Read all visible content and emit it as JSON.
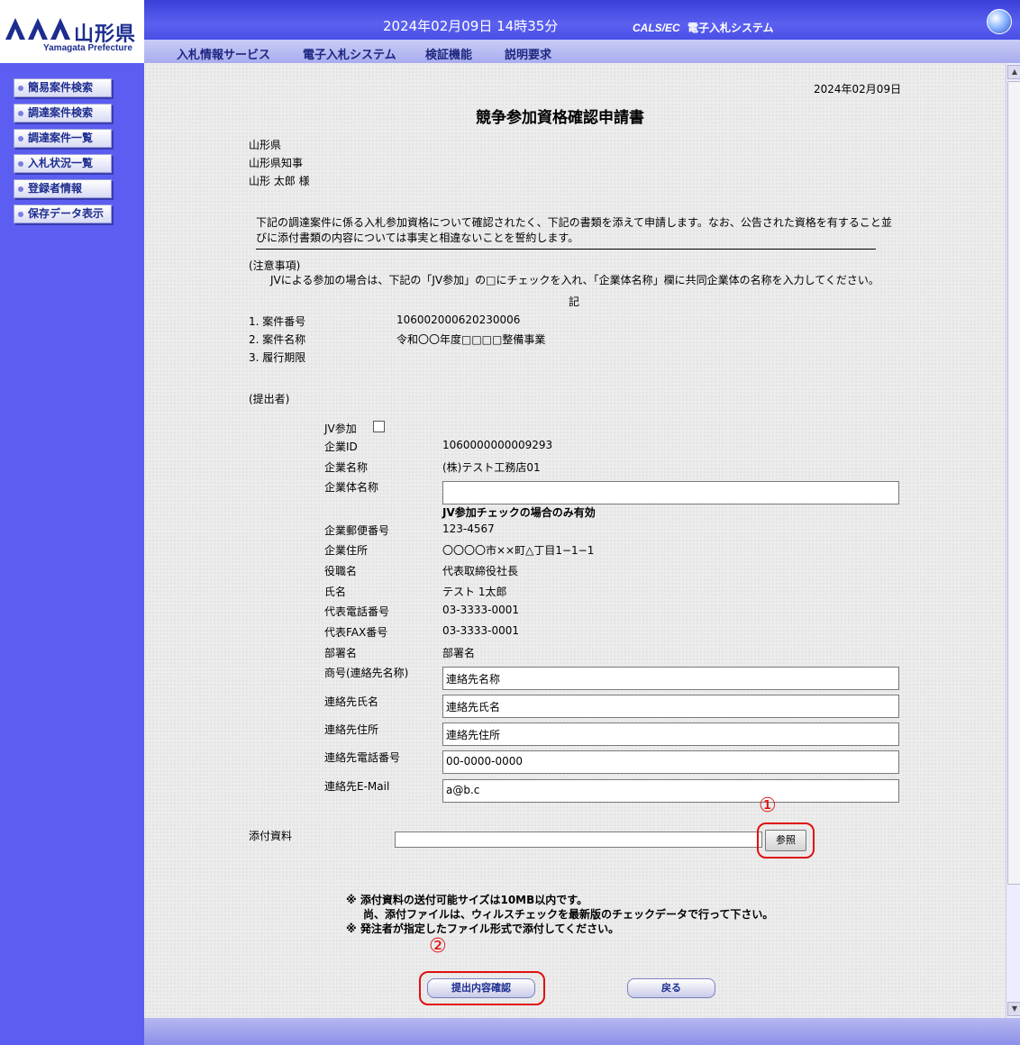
{
  "header": {
    "logo_text": "山形県",
    "logo_subtext": "Yamagata Prefecture",
    "datetime": "2024年02月09日  14時35分",
    "system_title_prefix": "CALS/EC",
    "system_title": "電子入札システム",
    "globe_icon": "globe-icon"
  },
  "menu": [
    "入札情報サービス",
    "電子入札システム",
    "検証機能",
    "説明要求"
  ],
  "sidebar": [
    "簡易案件検索",
    "調達案件検索",
    "調達案件一覧",
    "入札状況一覧",
    "登録者情報",
    "保存データ表示"
  ],
  "form": {
    "date": "2024年02月09日",
    "title": "競争参加資格確認申請書",
    "recipient": [
      "山形県",
      "山形県知事",
      "山形  太郎  様"
    ],
    "intro_line1": "下記の調達案件に係る入札参加資格について確認されたく、下記の書類を添えて申請します。なお、公告された資格を有すること並",
    "intro_line2": "びに添付書類の内容については事実と相違ないことを誓約します。",
    "notes_heading": "(注意事項)",
    "notes_text": "JVによる参加の場合は、下記の「JV参加」の□にチェックを入れ、「企業体名称」欄に共同企業体の名称を入力してください。",
    "ki": "記",
    "case_items": [
      {
        "label": "1. 案件番号",
        "value": "106002000620230006"
      },
      {
        "label": "2. 案件名称",
        "value": "令和〇〇年度□□□□整備事業"
      },
      {
        "label": "3. 履行期限",
        "value": ""
      }
    ],
    "submitter_heading": "(提出者)",
    "jv_label": "JV参加",
    "company_id_label": "企業ID",
    "company_id": "1060000000009293",
    "company_name_label": "企業名称",
    "company_name": "(株)テスト工務店01",
    "consortium_label": "企業体名称",
    "consortium_value": "",
    "consortium_note": "JV参加チェックの場合のみ有効",
    "postal_label": "企業郵便番号",
    "postal": "123-4567",
    "address_label": "企業住所",
    "address": "〇〇〇〇市××町△丁目1−1−1",
    "position_label": "役職名",
    "position": "代表取締役社長",
    "name_label": "氏名",
    "name": "テスト  1太郎",
    "phone_label": "代表電話番号",
    "phone": "03-3333-0001",
    "fax_label": "代表FAX番号",
    "fax": "03-3333-0001",
    "dept_label": "部署名",
    "dept": "部署名",
    "contact_company_label": "商号(連絡先名称)",
    "contact_company": "連絡先名称",
    "contact_name_label": "連絡先氏名",
    "contact_name": "連絡先氏名",
    "contact_address_label": "連絡先住所",
    "contact_address": "連絡先住所",
    "contact_phone_label": "連絡先電話番号",
    "contact_phone": "00-0000-0000",
    "contact_email_label": "連絡先E-Mail",
    "contact_email": "a@b.c",
    "attachment_label": "添付資料",
    "attachment_value": "",
    "browse_button": "参照",
    "notice1": "※ 添付資料の送付可能サイズは10MB以内です。",
    "notice2": "尚、添付ファイルは、ウィルスチェックを最新版のチェックデータで行って下さい。",
    "notice3": "※ 発注者が指定したファイル形式で添付してください。",
    "submit_button": "提出内容確認",
    "back_button": "戻る"
  },
  "annotations": {
    "marker1": "①",
    "marker2": "②"
  },
  "colors": {
    "sidebar": "#5b5ef0",
    "topbar": "#4a4fe6",
    "annotation": "#e01010"
  }
}
